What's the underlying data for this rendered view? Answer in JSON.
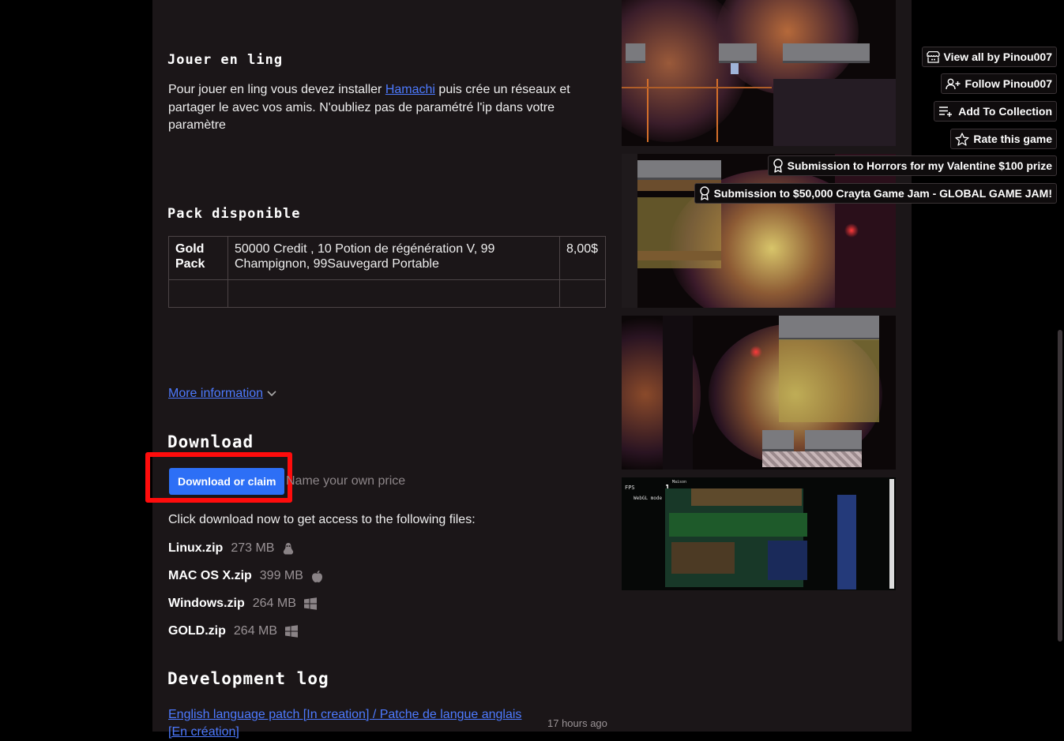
{
  "section_online": {
    "heading": "Jouer en ling",
    "text_before": "Pour jouer en ling vous devez installer ",
    "link": "Hamachi",
    "text_after": " puis crée un réseaux et partager le avec vos amis. N'oubliez pas de paramétré l'ip dans votre paramètre"
  },
  "pack": {
    "heading": "Pack disponible",
    "rows": [
      {
        "name": "Gold Pack",
        "desc": " 50000 Credit , 10 Potion de régénération V, 99 Champignon, 99Sauvegard Portable",
        "price": "8,00$"
      },
      {
        "name": "",
        "desc": "",
        "price": ""
      }
    ]
  },
  "more_info": "More information",
  "download": {
    "heading": "Download",
    "button": "Download or claim",
    "price_hint": "Name your own price",
    "intro": "Click download now to get access to the following files:",
    "files": [
      {
        "name": "Linux.zip",
        "size": "273 MB",
        "icon": "linux-icon"
      },
      {
        "name": "MAC OS X.zip",
        "size": "399 MB",
        "icon": "apple-icon"
      },
      {
        "name": "Windows.zip",
        "size": "264 MB",
        "icon": "windows-icon"
      },
      {
        "name": "GOLD.zip",
        "size": "264 MB",
        "icon": "windows-icon"
      }
    ]
  },
  "devlog": {
    "heading": "Development log",
    "entry_title": "English language patch [In creation] / Patche de langue anglais [En création]",
    "entry_time": "17 hours ago"
  },
  "sidebar": {
    "view_all": "View all by Pinou007",
    "follow": "Follow Pinou007",
    "add_collection": "Add To Collection",
    "rate": "Rate this game",
    "submission1": "Submission to Horrors for my Valentine $100 prize",
    "submission2": "Submission to $50,000 Crayta Game Jam - GLOBAL GAME JAM!"
  },
  "screenshot4": {
    "fps_label": "FPS",
    "fps_value": "1",
    "mode": "WebGL mode",
    "corner": "Maison"
  },
  "colors": {
    "accent": "#2d6ff6",
    "link": "#4d7aff",
    "highlight": "#ff0c0c",
    "page_bg": "#1b1618"
  }
}
